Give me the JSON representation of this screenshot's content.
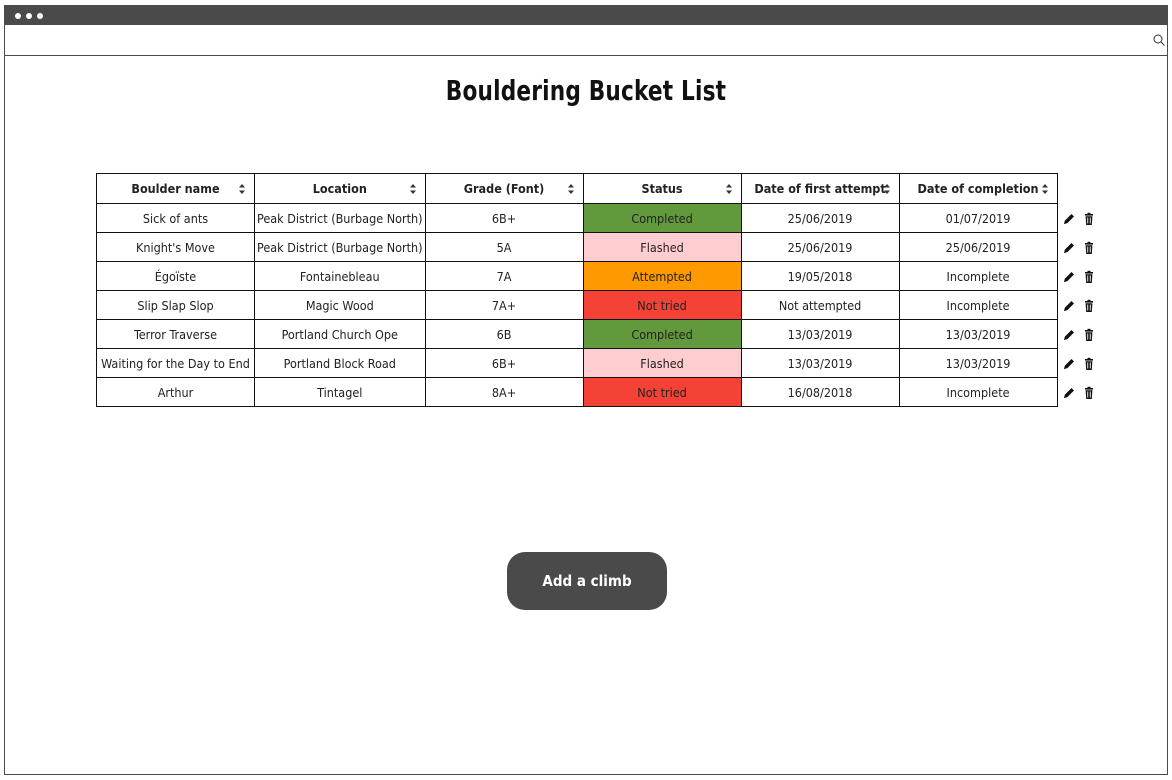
{
  "page": {
    "title": "Bouldering Bucket List"
  },
  "table": {
    "headers": [
      "Boulder name",
      "Location",
      "Grade (Font)",
      "Status",
      "Date of first attempt",
      "Date of completion"
    ],
    "rows": [
      {
        "name": "Sick of ants",
        "location": "Peak District (Burbage North)",
        "grade": "6B+",
        "status": "Completed",
        "status_key": "completed",
        "first_attempt": "25/06/2019",
        "completion": "01/07/2019"
      },
      {
        "name": "Knight's Move",
        "location": "Peak District (Burbage North)",
        "grade": "5A",
        "status": "Flashed",
        "status_key": "flashed",
        "first_attempt": "25/06/2019",
        "completion": "25/06/2019"
      },
      {
        "name": "Égoïste",
        "location": "Fontainebleau",
        "grade": "7A",
        "status": "Attempted",
        "status_key": "attempted",
        "first_attempt": "19/05/2018",
        "completion": "Incomplete"
      },
      {
        "name": "Slip Slap Slop",
        "location": "Magic Wood",
        "grade": "7A+",
        "status": "Not tried",
        "status_key": "not-tried",
        "first_attempt": "Not attempted",
        "completion": "Incomplete"
      },
      {
        "name": "Terror Traverse",
        "location": "Portland Church Ope",
        "grade": "6B",
        "status": "Completed",
        "status_key": "completed",
        "first_attempt": "13/03/2019",
        "completion": "13/03/2019"
      },
      {
        "name": "Waiting for the Day to End",
        "location": "Portland Block Road",
        "grade": "6B+",
        "status": "Flashed",
        "status_key": "flashed",
        "first_attempt": "13/03/2019",
        "completion": "13/03/2019"
      },
      {
        "name": "Arthur",
        "location": "Tintagel",
        "grade": "8A+",
        "status": "Not tried",
        "status_key": "not-tried",
        "first_attempt": "16/08/2018",
        "completion": "Incomplete"
      }
    ]
  },
  "status_colors": {
    "completed": "#63993d",
    "flashed": "#ffcccf",
    "attempted": "#ff9900",
    "not-tried": "#f44336"
  },
  "icons": {
    "edit": "pencil-icon",
    "delete": "trash-icon",
    "sort": "sort-icon",
    "search": "search-icon"
  },
  "actions": {
    "add_label": "Add a climb"
  }
}
